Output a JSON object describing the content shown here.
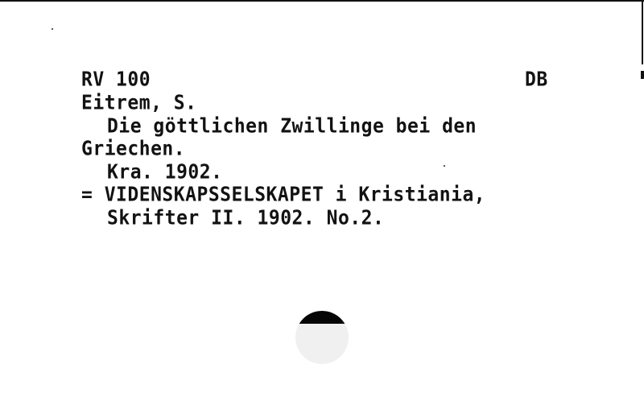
{
  "card": {
    "call_number": "RV 100",
    "location_code": "DB",
    "author": "Eitrem, S.",
    "title_line1": "Die göttlichen Zwillinge bei den",
    "title_line2": "Griechen.",
    "imprint": "Kra. 1902.",
    "series_line1": "= VIDENSKAPSSELSKAPET i Kristiania,",
    "series_line2": "Skrifter II. 1902. No.2."
  }
}
